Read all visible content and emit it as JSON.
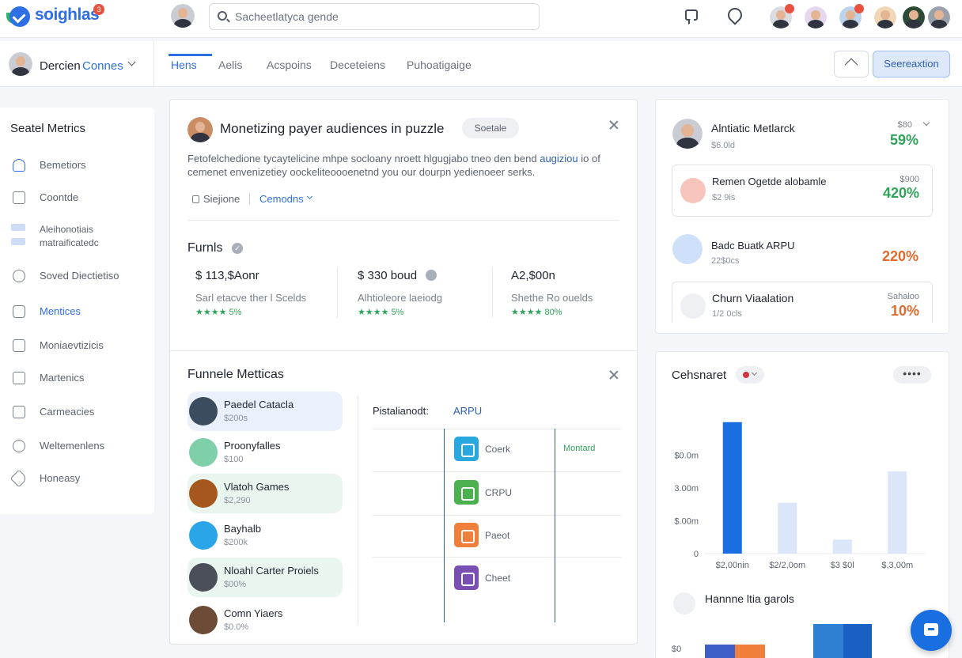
{
  "app": {
    "name": "soighlas",
    "notification_count": "3"
  },
  "search": {
    "placeholder": "Sacheetlatyca gende"
  },
  "header_avatars": [
    "avatar-1",
    "avatar-2",
    "avatar-3",
    "avatar-4",
    "avatar-5",
    "avatar-6"
  ],
  "user": {
    "name": "Dercien",
    "org": "Connes"
  },
  "tabs": [
    {
      "label": "Hens",
      "active": true
    },
    {
      "label": "Aelis",
      "active": false
    },
    {
      "label": "Acspoins",
      "active": false
    },
    {
      "label": "Deceteiens",
      "active": false
    },
    {
      "label": "Puhoatigaige",
      "active": false
    }
  ],
  "actions": {
    "primary_label": "Seereaxtion"
  },
  "sidebar": {
    "title": "Seatel Metrics",
    "items": [
      {
        "label": "Bemetiors",
        "icon": "bell-icon",
        "active": false
      },
      {
        "label": "Coontde",
        "icon": "document-icon",
        "active": false
      },
      {
        "label": "Aleihonotiais\nmatraificatedc",
        "icon": "grid-icon",
        "active": false
      },
      {
        "label": "Soved Diectietiso",
        "icon": "chat-bubble-icon",
        "active": false
      },
      {
        "label": "Mentices",
        "icon": "puzzle-icon",
        "active": true
      },
      {
        "label": "Moniaevtizicis",
        "icon": "wallet-icon",
        "active": false
      },
      {
        "label": "Martenics",
        "icon": "mail-icon",
        "active": false
      },
      {
        "label": "Carmeacies",
        "icon": "calendar-icon",
        "active": false
      },
      {
        "label": "Weltemenlens",
        "icon": "target-icon",
        "active": false
      },
      {
        "label": "Honeasy",
        "icon": "tag-icon",
        "active": false
      }
    ]
  },
  "card": {
    "title": "Monetizing payer audiences in puzzle",
    "badge": "Soetale",
    "description_start": "Fetofelchedione tycaytelicine mhpe socloany nroett hlgugjabo tneo den bend",
    "description_link": "augiziou",
    "description_end": " io of cemenet envenizetiey oockeliteoooenetnd you our dourpn yedienoeer serks.",
    "meta_label": "Siejione",
    "meta_link": "Cemodns",
    "funnels_title": "Furnls",
    "stats": [
      {
        "value": "$ 113,$Aonr",
        "label": "Sarl etacve ther l Scelds",
        "stars": "★★★★ 5%"
      },
      {
        "value": "$ 330 boud",
        "label": "Alhtioleore laeiodg",
        "stars": "★★★★ 5%"
      },
      {
        "value": "A2,$00n",
        "label": "Shethe Ro ouelds",
        "stars": "★★★★ 80%"
      }
    ],
    "funnel_metrics_title": "Funnele Metticas",
    "games": [
      {
        "name": "Paedel Catacla",
        "sub": "$200s",
        "color": "#3b4c5e",
        "highlight": "#eaf1fd"
      },
      {
        "name": "Proonyfalles",
        "sub": "$100",
        "color": "#7fcfa8",
        "highlight": ""
      },
      {
        "name": "Vlatoh Games",
        "sub": "$2,290",
        "color": "#a5571f",
        "highlight": "#e9f6ef"
      },
      {
        "name": "Bayhalb",
        "sub": "$200k",
        "color": "#2aa5e8",
        "highlight": ""
      },
      {
        "name": "Nloahl Carter Proiels",
        "sub": "$00%",
        "color": "#4a4f58",
        "highlight": "#e9f6ef"
      },
      {
        "name": "Comn Yiaers",
        "sub": "$0.0%",
        "color": "#6d4b36",
        "highlight": ""
      }
    ],
    "grid": {
      "label_a": "Pistalianodt:",
      "label_b": "ARPU",
      "extra": "Montard",
      "items": [
        {
          "label": "Coerk",
          "color": "#29a8df",
          "icon": "list-icon"
        },
        {
          "label": "CRPU",
          "color": "#4caf50",
          "icon": "check-icon"
        },
        {
          "label": "Paeot",
          "color": "#f07f3c",
          "icon": "smile-icon"
        },
        {
          "label": "Cheet",
          "color": "#7a4fb3",
          "icon": "calendar-icon"
        }
      ]
    }
  },
  "right_panel": {
    "rows": [
      {
        "name": "Alntiatic Metlarck",
        "sub": "$6.0ld",
        "small": "$80",
        "value": "59%",
        "value_color": "#2fa35a",
        "icon_color": "#4a4f58"
      },
      {
        "name": "Remen Ogetde alobamle",
        "sub": "$2 9is",
        "small": "$900",
        "value": "420%",
        "value_color": "#2fa35a",
        "icon_color": "#f7c4bb"
      },
      {
        "name": "Badc Buatk ARPU",
        "sub": "22$0cs",
        "small": "",
        "value": "220%",
        "value_color": "#e06a2c",
        "icon_color": "#cfe0fa"
      },
      {
        "name": "Churn Viaalation",
        "sub": "1/2 0cls",
        "small": "Sahaloo",
        "value": "10%",
        "value_color": "#e06a2c",
        "icon_color": "#eef0f3"
      }
    ]
  },
  "chart_card": {
    "title": "Cehsnaret",
    "menu": "••••",
    "second_title": "Hannne ltia garols"
  },
  "chart_data": {
    "type": "bar",
    "title": "Cehsnaret",
    "categories": [
      "$2,00nin",
      "$2/2,0om",
      "$3 $0l",
      "$,3,00m"
    ],
    "values": [
      8.0,
      3.1,
      0.85,
      5.0
    ],
    "bar_colors": [
      "#1a6fe0",
      "#dbe6f8",
      "#dbe6f8",
      "#dbe6f8"
    ],
    "y_ticks": [
      "0",
      "$.00m",
      "3.00m",
      "$0.0m"
    ],
    "y_tick_values": [
      0,
      2,
      4,
      6
    ],
    "ylim": [
      0,
      9
    ]
  },
  "colors": {
    "accent": "#2f6fe4",
    "success": "#2fa35a",
    "warning": "#e06a2c",
    "fab": "#1a6fe0"
  }
}
